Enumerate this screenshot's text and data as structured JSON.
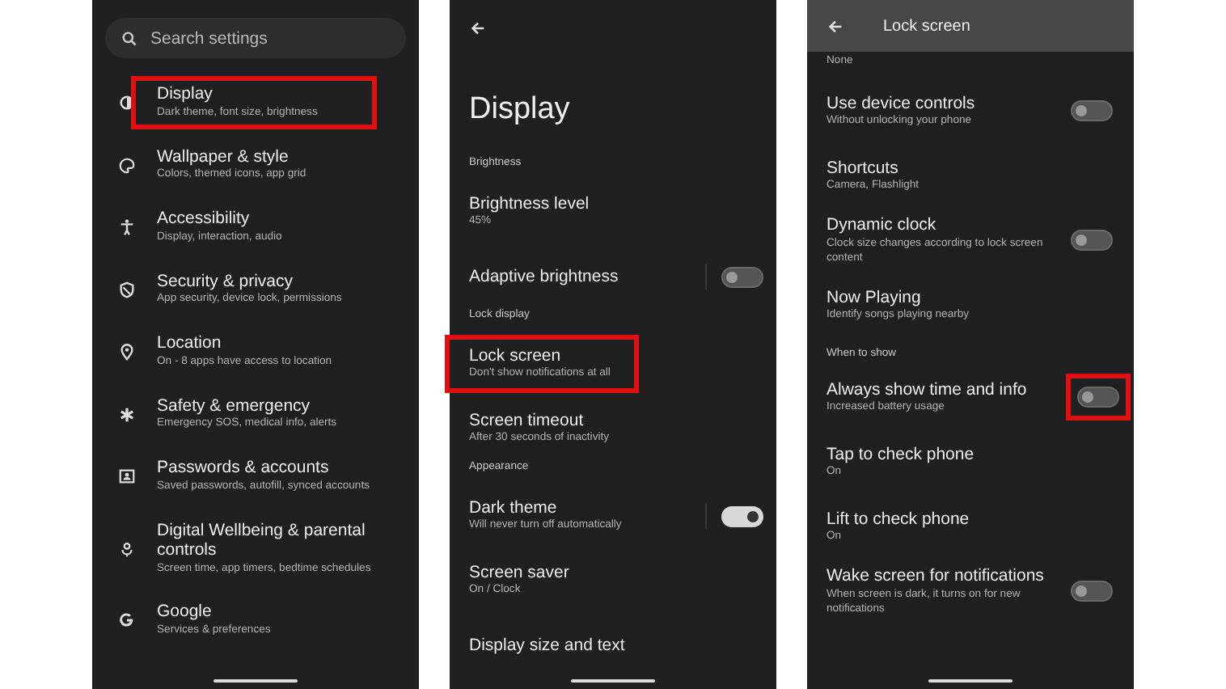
{
  "settings": {
    "search": {
      "placeholder": "Search settings"
    },
    "items": [
      {
        "title": "Display",
        "subtitle": "Dark theme, font size, brightness",
        "highlighted": true
      },
      {
        "title": "Wallpaper & style",
        "subtitle": "Colors, themed icons, app grid",
        "highlighted": false
      },
      {
        "title": "Accessibility",
        "subtitle": "Display, interaction, audio",
        "highlighted": false
      },
      {
        "title": "Security & privacy",
        "subtitle": "App security, device lock, permissions",
        "highlighted": false
      },
      {
        "title": "Location",
        "subtitle": "On - 8 apps have access to location",
        "highlighted": false
      },
      {
        "title": "Safety & emergency",
        "subtitle": "Emergency SOS, medical info, alerts",
        "highlighted": false
      },
      {
        "title": "Passwords & accounts",
        "subtitle": "Saved passwords, autofill, synced accounts",
        "highlighted": false
      },
      {
        "title": "Digital Wellbeing & parental controls",
        "subtitle": "Screen time, app timers, bedtime schedules",
        "highlighted": false
      },
      {
        "title": "Google",
        "subtitle": "Services & preferences",
        "highlighted": false
      }
    ]
  },
  "display": {
    "title": "Display",
    "rows": [
      {
        "kind": "header",
        "title": "Brightness"
      },
      {
        "kind": "item",
        "title": "Brightness level",
        "subtitle": "45%",
        "highlighted": false
      },
      {
        "kind": "switch",
        "title": "Adaptive brightness",
        "on": false,
        "highlighted": false
      },
      {
        "kind": "header",
        "title": "Lock display"
      },
      {
        "kind": "item",
        "title": "Lock screen",
        "subtitle": "Don't show notifications at all",
        "highlighted": true
      },
      {
        "kind": "item",
        "title": "Screen timeout",
        "subtitle": "After 30 seconds of inactivity",
        "highlighted": false
      },
      {
        "kind": "header",
        "title": "Appearance"
      },
      {
        "kind": "switch",
        "title": "Dark theme",
        "subtitle": "Will never turn off automatically",
        "on": true,
        "highlighted": false
      },
      {
        "kind": "item",
        "title": "Screen saver",
        "subtitle": "On / Clock",
        "highlighted": false
      },
      {
        "kind": "item",
        "title": "Display size and text",
        "highlighted": false
      }
    ]
  },
  "lock_screen": {
    "title": "Lock screen",
    "top_text": "None",
    "rows": [
      {
        "kind": "switch",
        "title": "Use device controls",
        "subtitle": "Without unlocking your phone",
        "on": false,
        "highlighted": false
      },
      {
        "kind": "item",
        "title": "Shortcuts",
        "subtitle": "Camera, Flashlight",
        "highlighted": false
      },
      {
        "kind": "switch",
        "title": "Dynamic clock",
        "subtitle": "Clock size changes according to lock screen content",
        "on": false,
        "highlighted": false
      },
      {
        "kind": "item",
        "title": "Now Playing",
        "subtitle": "Identify songs playing nearby",
        "highlighted": false
      },
      {
        "kind": "header",
        "title": "When to show"
      },
      {
        "kind": "switch",
        "title": "Always show time and info",
        "subtitle": "Increased battery usage",
        "on": false,
        "highlighted": true
      },
      {
        "kind": "item",
        "title": "Tap to check phone",
        "subtitle": "On",
        "highlighted": false
      },
      {
        "kind": "item",
        "title": "Lift to check phone",
        "subtitle": "On",
        "highlighted": false
      },
      {
        "kind": "switch",
        "title": "Wake screen for notifications",
        "subtitle": "When screen is dark, it turns on for new notifications",
        "on": false,
        "highlighted": false
      }
    ]
  }
}
